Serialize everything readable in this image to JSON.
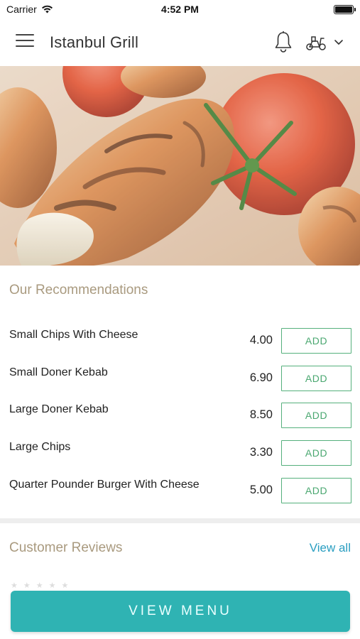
{
  "status_bar": {
    "carrier": "Carrier",
    "time": "4:52 PM"
  },
  "header": {
    "title": "Istanbul Grill",
    "icons": [
      "menu-icon",
      "bell-icon",
      "scooter-icon",
      "chevron-down-icon"
    ]
  },
  "hero": {
    "icon": "food-photo"
  },
  "recommendations": {
    "title": "Our Recommendations",
    "add_label": "ADD",
    "items": [
      {
        "name": "Small Chips With Cheese",
        "price": "4.00"
      },
      {
        "name": "Small Doner Kebab",
        "price": "6.90"
      },
      {
        "name": "Large Doner Kebab",
        "price": "8.50"
      },
      {
        "name": "Large Chips",
        "price": "3.30"
      },
      {
        "name": "Quarter Pounder Burger With Cheese",
        "price": "5.00"
      }
    ]
  },
  "reviews": {
    "title": "Customer Reviews",
    "view_all_label": "View all"
  },
  "footer": {
    "view_menu_label": "VIEW MENU"
  },
  "colors": {
    "accent_teal": "#2fb3b3",
    "add_green": "#4aa770",
    "section_title": "#a99a7f",
    "link_blue": "#2a9ec1"
  }
}
